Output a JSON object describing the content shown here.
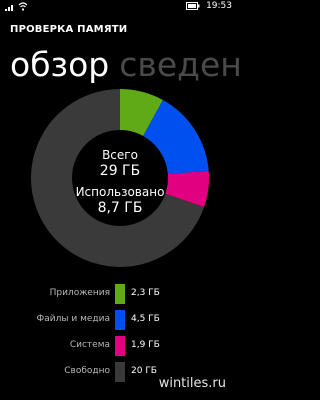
{
  "status_bar": {
    "time": "19:53"
  },
  "app": {
    "title": "ПРОВЕРКА ПАМЯТИ"
  },
  "pivot": {
    "tabs": [
      "обзор",
      "сведени"
    ],
    "active_index": 0
  },
  "summary": {
    "total_label": "Всего",
    "total_value": "29 ГБ",
    "used_label": "Использовано",
    "used_value": "8,7 ГБ"
  },
  "chart_data": {
    "type": "pie",
    "categories": [
      "Приложения",
      "Файлы и медиа",
      "Система",
      "Свободно"
    ],
    "values": [
      2.3,
      4.5,
      1.9,
      20
    ],
    "colors": [
      "#60a917",
      "#0050ef",
      "#e10080",
      "#3a3a3a"
    ],
    "unit": "ГБ",
    "donut": true
  },
  "legend": [
    {
      "label": "Приложения",
      "value": "2,3 ГБ",
      "color": "#60a917"
    },
    {
      "label": "Файлы и медиа",
      "value": "4,5 ГБ",
      "color": "#0050ef"
    },
    {
      "label": "Система",
      "value": "1,9 ГБ",
      "color": "#e10080"
    },
    {
      "label": "Свободно",
      "value": "20 ГБ",
      "color": "#3a3a3a"
    }
  ],
  "watermark": "wintiles.ru"
}
